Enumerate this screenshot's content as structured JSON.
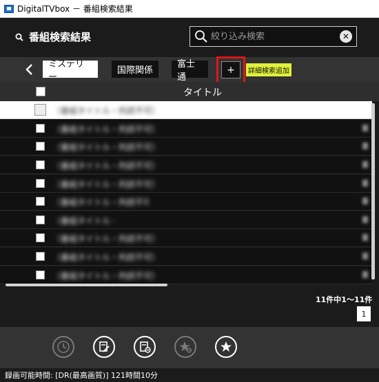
{
  "window": {
    "title": "DigitalTVbox － 番組検索結果"
  },
  "header": {
    "page_title": "番組検索結果",
    "search": {
      "placeholder": "絞り込み検索",
      "value": ""
    }
  },
  "tags": {
    "items": [
      {
        "label": "ミステリー",
        "active": true
      },
      {
        "label": "国際関係",
        "active": false
      },
      {
        "label": "富士通",
        "active": false
      }
    ],
    "add_label": "+",
    "add_tooltip": "詳細検索追加"
  },
  "table": {
    "column_title": "タイトル",
    "rows": [
      {
        "title": "（番組タイトル・判読不可）"
      },
      {
        "title": "（番組タイトル・判読不可）"
      },
      {
        "title": "（番組タイトル・判読不可）"
      },
      {
        "title": "（番組タイトル・判読不可）"
      },
      {
        "title": "（番組タイトル・判読不可）"
      },
      {
        "title": "（番組タイトル・判読不可）"
      },
      {
        "title": "（番組タイトル・判読不可）"
      },
      {
        "title": "（番組タイトル・判読不可）"
      },
      {
        "title": "（番組タイトル・判読不可）"
      },
      {
        "title": "（番組タイトル・判読不可）"
      }
    ]
  },
  "pagination": {
    "count_text": "11件中1～11件",
    "current_page": "1"
  },
  "actions": [
    {
      "icon": "clock-icon",
      "enabled": false
    },
    {
      "icon": "edit-reservation-icon",
      "enabled": true
    },
    {
      "icon": "delete-reservation-icon",
      "enabled": false
    },
    {
      "icon": "remove-favorite-icon",
      "enabled": false
    },
    {
      "icon": "add-favorite-icon",
      "enabled": true
    }
  ],
  "status": {
    "text": "録画可能時間: [DR(最高画質)] 121時間10分"
  },
  "colors": {
    "highlight_border": "#e01616",
    "tooltip_bg": "#dff23a",
    "background": "#1b1b1b",
    "bar": "#333333"
  }
}
